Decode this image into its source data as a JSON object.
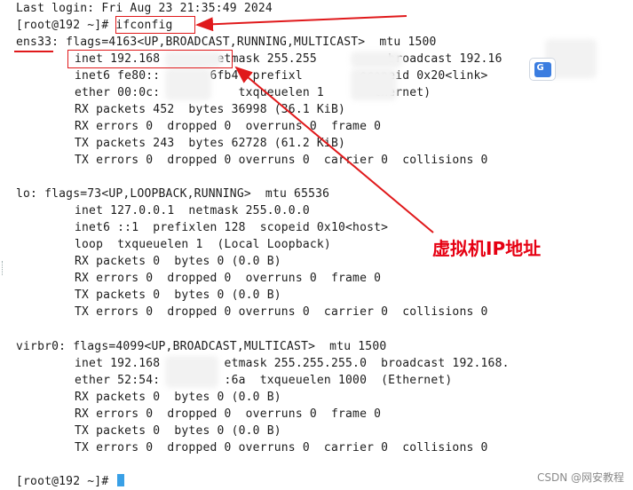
{
  "terminal": {
    "lines": [
      "Last login: Fri Aug 23 21:35:49 2024",
      "[root@192 ~]# ifconfig",
      "ens33: flags=4163<UP,BROADCAST,RUNNING,MULTICAST>  mtu 1500",
      "inet 192.168        etmask 255.255          broadcast 192.16",
      "inet6 fe80::       6fb4  prefixl        scopeid 0x20<link>",
      "ether 00:0c:           txqueuelen 1       thernet)",
      "RX packets 452  bytes 36998 (36.1 KiB)",
      "RX errors 0  dropped 0  overruns 0  frame 0",
      "TX packets 243  bytes 62728 (61.2 KiB)",
      "TX errors 0  dropped 0 overruns 0  carrier 0  collisions 0",
      "lo: flags=73<UP,LOOPBACK,RUNNING>  mtu 65536",
      "inet 127.0.0.1  netmask 255.0.0.0",
      "inet6 ::1  prefixlen 128  scopeid 0x10<host>",
      "loop  txqueuelen 1  (Local Loopback)",
      "RX packets 0  bytes 0 (0.0 B)",
      "RX errors 0  dropped 0  overruns 0  frame 0",
      "TX packets 0  bytes 0 (0.0 B)",
      "TX errors 0  dropped 0 overruns 0  carrier 0  collisions 0",
      "virbr0: flags=4099<UP,BROADCAST,MULTICAST>  mtu 1500",
      "inet 192.168         etmask 255.255.255.0  broadcast 192.168.",
      "ether 52:54:         :6a  txqueuelen 1000  (Ethernet)",
      "RX packets 0  bytes 0 (0.0 B)",
      "RX errors 0  dropped 0  overruns 0  frame 0",
      "TX packets 0  bytes 0 (0.0 B)",
      "TX errors 0  dropped 0 overruns 0  carrier 0  collisions 0",
      "[root@192 ~]# "
    ]
  },
  "annotation": {
    "label": "虚拟机IP地址",
    "color": "#e60012"
  },
  "translate_button": {
    "glyph": "G",
    "icon": "translate-icon"
  },
  "watermark": {
    "text": "CSDN @网安教程"
  }
}
